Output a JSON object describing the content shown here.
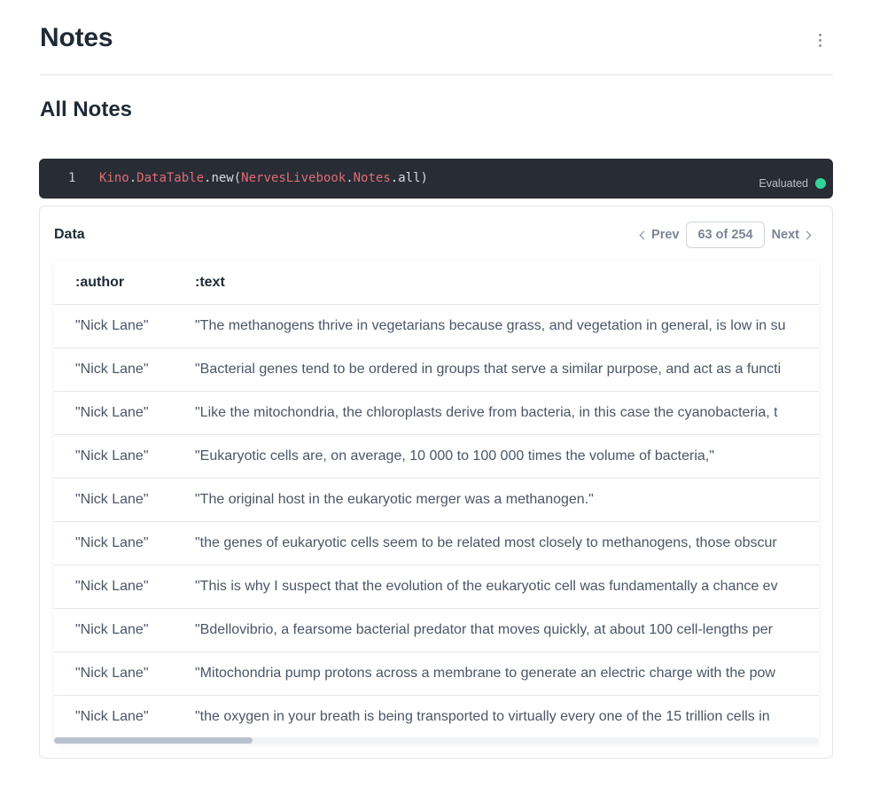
{
  "page": {
    "title": "Notes",
    "section_title": "All Notes"
  },
  "code_cell": {
    "line_number": "1",
    "tokens": [
      "Kino",
      ".",
      "DataTable",
      ".new(",
      "NervesLivebook",
      ".",
      "Notes",
      ".all)"
    ],
    "status": "Evaluated",
    "status_color": "#34d399"
  },
  "output": {
    "label": "Data",
    "pager": {
      "prev_label": "Prev",
      "page_indicator": "63 of 254",
      "next_label": "Next"
    },
    "table": {
      "columns": [
        ":author",
        ":text"
      ],
      "rows": [
        [
          "\"Nick Lane\"",
          "\"The methanogens thrive in vegetarians because grass, and vegetation in general, is low in su"
        ],
        [
          "\"Nick Lane\"",
          "\"Bacterial genes tend to be ordered in groups that serve a similar purpose, and act as a functi"
        ],
        [
          "\"Nick Lane\"",
          "\"Like the mitochondria, the chloroplasts derive from bacteria, in this case the cyanobacteria, t"
        ],
        [
          "\"Nick Lane\"",
          "\"Eukaryotic cells are, on average, 10 000 to 100 000 times the volume of bacteria,\""
        ],
        [
          "\"Nick Lane\"",
          "\"The original host in the eukaryotic merger was a methanogen.\""
        ],
        [
          "\"Nick Lane\"",
          "\"the genes of eukaryotic cells seem to be related most closely to methanogens, those obscur"
        ],
        [
          "\"Nick Lane\"",
          "\"This is why I suspect that the evolution of the eukaryotic cell was fundamentally a chance ev"
        ],
        [
          "\"Nick Lane\"",
          "\"Bdellovibrio, a fearsome bacterial predator that moves quickly, at about 100 cell-lengths per"
        ],
        [
          "\"Nick Lane\"",
          "\"Mitochondria pump protons across a membrane to generate an electric charge with the pow"
        ],
        [
          "\"Nick Lane\"",
          "\"the oxygen in your breath is being transported to virtually every one of the 15 trillion cells in "
        ]
      ]
    }
  },
  "icons": {
    "menu": "vertical-dots-icon",
    "prev": "chevron-left-icon",
    "next": "chevron-right-icon"
  }
}
